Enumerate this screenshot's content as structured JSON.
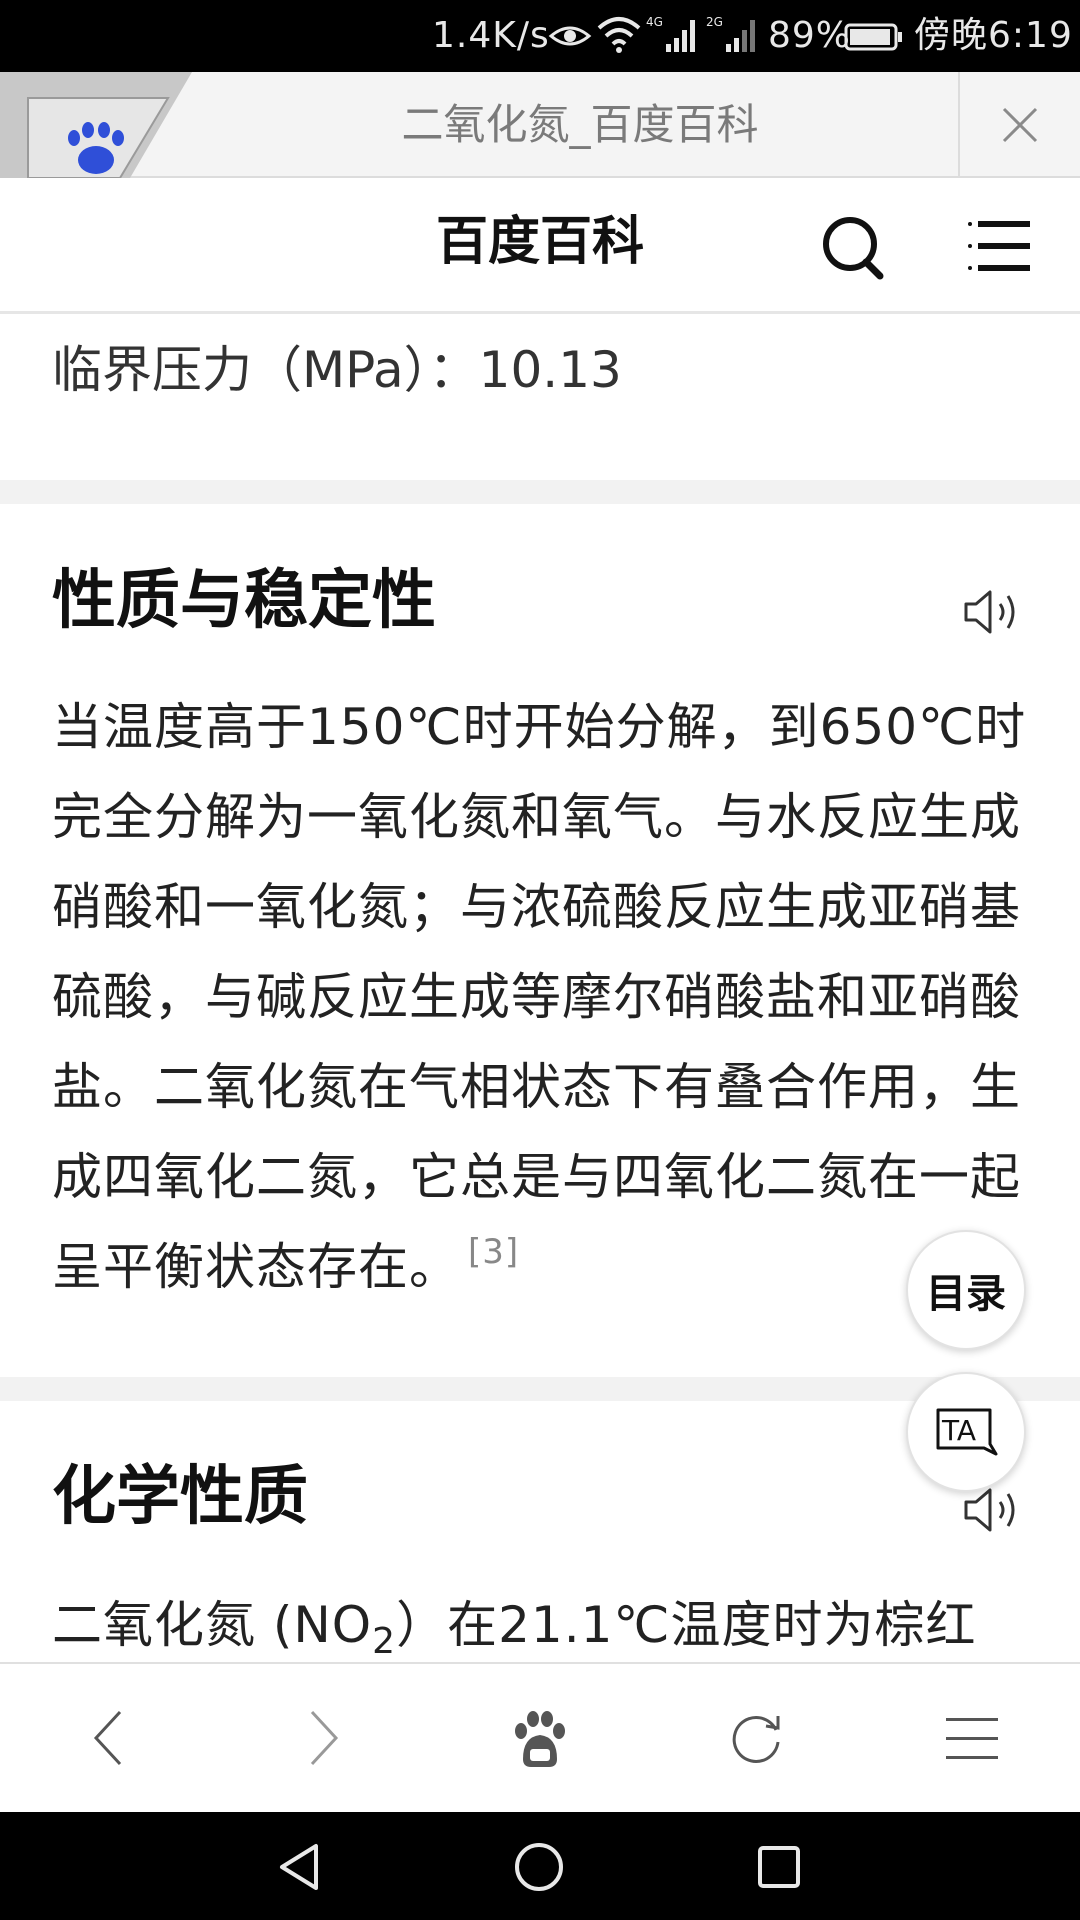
{
  "status_bar": {
    "net_speed": "1.4K/s",
    "battery_percent": "89%",
    "time": "傍晚6:19",
    "signal_labels": [
      "4G",
      "2G"
    ],
    "icons": [
      "eye-icon",
      "wifi-icon",
      "signal-icon",
      "signal-icon",
      "battery-icon"
    ]
  },
  "tab_bar": {
    "title": "二氧化氮_百度百科",
    "favicon": "baidu-paw-icon",
    "close_icon": "close-icon"
  },
  "header": {
    "site_title": "百度百科",
    "search_icon": "search-icon",
    "menu_icon": "menu-icon"
  },
  "content": {
    "property_line": "临界压力（MPa）：10.13",
    "section1": {
      "title": "性质与稳定性",
      "speaker_icon": "speaker-icon",
      "paragraph": "当温度高于150℃时开始分解，到650℃时完全分解为一氧化氮和氧气。与水反应生成硝酸和一氧化氮；与浓硫酸反应生成亚硝基硫酸，与碱反应生成等摩尔硝酸盐和亚硝酸盐。二氧化氮在气相状态下有叠合作用，生成四氧化二氮，它总是与四氧化二氮在一起呈平衡状态存在。",
      "citation": "[3]"
    },
    "section2": {
      "title": "化学性质",
      "speaker_icon": "speaker-icon",
      "paragraph_start": "二氧化氮 (NO",
      "subscript": "2",
      "paragraph_end": "）在21.1℃温度时为棕红"
    }
  },
  "floating": {
    "toc_label": "目录",
    "ta_label": "TA"
  },
  "toolbar": {
    "icons": [
      "back-icon",
      "forward-icon",
      "baidu-home-icon",
      "refresh-icon",
      "menu-icon"
    ]
  },
  "nav_bar": {
    "icons": [
      "nav-back-icon",
      "nav-home-icon",
      "nav-recent-icon"
    ]
  },
  "colors": {
    "status_bar_bg": "#000000",
    "tab_bar_bg": "#f4f4f4",
    "baidu_blue": "#2f4fd8",
    "section_gap": "#f2f2f2"
  }
}
